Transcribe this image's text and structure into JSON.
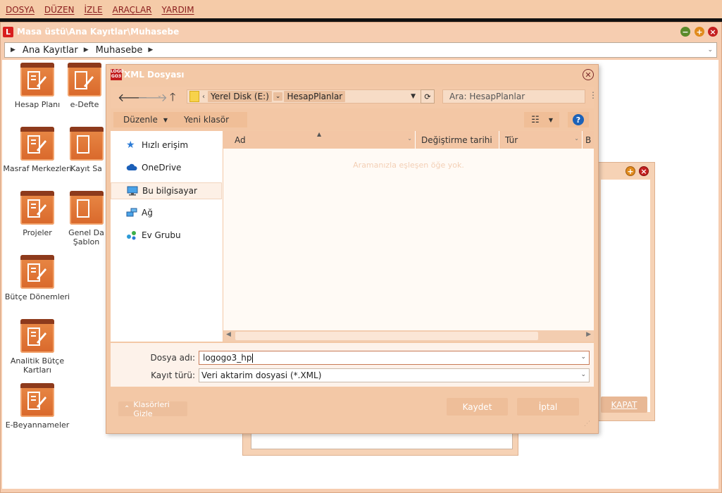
{
  "menu": [
    "DOSYA",
    "DÜZEN",
    "İZLE",
    "ARAÇLAR",
    "YARDIM"
  ],
  "main_window": {
    "title": "Masa üstü\\Ana Kayıtlar\\Muhasebe",
    "logo_text": "L",
    "breadcrumb": [
      "Ana Kayıtlar",
      "Muhasebe"
    ]
  },
  "desktop_icons": [
    {
      "label": "Hesap Planı"
    },
    {
      "label": "e-Defte"
    },
    {
      "label": "Masraf Merkezleri"
    },
    {
      "label": "Kayıt Sa"
    },
    {
      "label": "Projeler"
    },
    {
      "label": "Genel Da"
    },
    {
      "label": "Şablon"
    },
    {
      "label": "Bütçe Dönemleri"
    },
    {
      "label": "Analitik Bütçe"
    },
    {
      "label": "Kartları"
    },
    {
      "label": "E-Beyannameler"
    }
  ],
  "background": {
    "kapat_label": "KAPAT"
  },
  "dialog": {
    "title": "XML Dosyası",
    "logo_text": [
      "LOGO",
      "GO3"
    ],
    "address": {
      "segments": [
        "Yerel Disk (E:)",
        "HesapPlanlar"
      ]
    },
    "search_placeholder": "Ara: HesapPlanlar",
    "toolbar": {
      "organize": "Düzenle",
      "new_folder": "Yeni klasör"
    },
    "nav_items": [
      "Hızlı erişim",
      "OneDrive",
      "Bu bilgisayar",
      "Ağ",
      "Ev Grubu"
    ],
    "selected_nav": "Bu bilgisayar",
    "columns": [
      "Ad",
      "Değiştirme tarihi",
      "Tür",
      "B"
    ],
    "empty_message": "Aramanızla eşleşen öğe yok.",
    "filename_label": "Dosya adı:",
    "filename_value": "logogo3_hp",
    "filetype_label": "Kayıt türü:",
    "filetype_value": "Veri aktarim dosyasi (*.XML)",
    "hide_folders": "Klasörleri Gizle",
    "save": "Kaydet",
    "cancel": "İptal"
  },
  "colors": {
    "accent": "#f3c8a6",
    "brand_red": "#d81e1e",
    "title_text": "#ffffff"
  }
}
